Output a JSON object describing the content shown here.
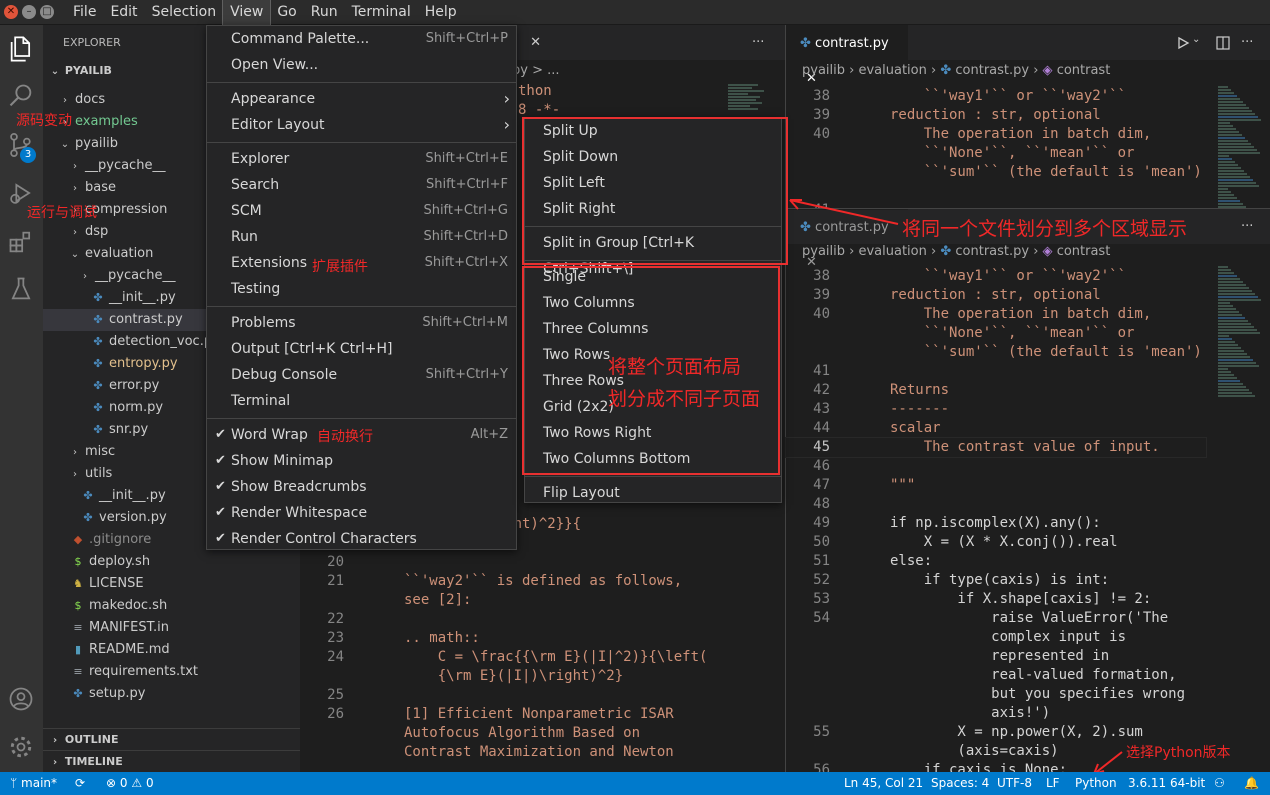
{
  "menubar": {
    "items": [
      "File",
      "Edit",
      "Selection",
      "View",
      "Go",
      "Run",
      "Terminal",
      "Help"
    ],
    "active": "View"
  },
  "sidebar": {
    "title": "EXPLORER",
    "root": "PYAILIB",
    "items": [
      {
        "label": "docs",
        "type": "folder",
        "depth": 1,
        "open": false
      },
      {
        "label": "examples",
        "type": "folder",
        "depth": 1,
        "open": false
      },
      {
        "label": "pyailib",
        "type": "folder",
        "depth": 1,
        "open": true
      },
      {
        "label": "__pycache__",
        "type": "folder",
        "depth": 2,
        "open": false
      },
      {
        "label": "base",
        "type": "folder",
        "depth": 2,
        "open": false
      },
      {
        "label": "compression",
        "type": "folder",
        "depth": 2,
        "open": false
      },
      {
        "label": "dsp",
        "type": "folder",
        "depth": 2,
        "open": false
      },
      {
        "label": "evaluation",
        "type": "folder",
        "depth": 2,
        "open": true
      },
      {
        "label": "__pycache__",
        "type": "folder",
        "depth": 3,
        "open": false
      },
      {
        "label": "__init__.py",
        "type": "py",
        "depth": 3
      },
      {
        "label": "contrast.py",
        "type": "py",
        "depth": 3,
        "selected": true
      },
      {
        "label": "detection_voc.py",
        "type": "py",
        "depth": 3
      },
      {
        "label": "entropy.py",
        "type": "py",
        "depth": 3
      },
      {
        "label": "error.py",
        "type": "py",
        "depth": 3
      },
      {
        "label": "norm.py",
        "type": "py",
        "depth": 3
      },
      {
        "label": "snr.py",
        "type": "py",
        "depth": 3
      },
      {
        "label": "misc",
        "type": "folder",
        "depth": 2,
        "open": false
      },
      {
        "label": "utils",
        "type": "folder",
        "depth": 2,
        "open": false
      },
      {
        "label": "__init__.py",
        "type": "py",
        "depth": 2
      },
      {
        "label": "version.py",
        "type": "py",
        "depth": 2
      },
      {
        "label": ".gitignore",
        "type": "git",
        "depth": 1
      },
      {
        "label": "deploy.sh",
        "type": "sh",
        "depth": 1
      },
      {
        "label": "LICENSE",
        "type": "lic",
        "depth": 1
      },
      {
        "label": "makedoc.sh",
        "type": "sh",
        "depth": 1
      },
      {
        "label": "MANIFEST.in",
        "type": "txt",
        "depth": 1
      },
      {
        "label": "README.md",
        "type": "md",
        "depth": 1
      },
      {
        "label": "requirements.txt",
        "type": "txt",
        "depth": 1
      },
      {
        "label": "setup.py",
        "type": "py",
        "depth": 1
      }
    ],
    "outline": "OUTLINE",
    "timeline": "TIMELINE"
  },
  "activity": {
    "scm_badge": "3"
  },
  "view_menu": [
    {
      "label": "Command Palette...",
      "kb": "Shift+Ctrl+P"
    },
    {
      "label": "Open View...",
      "kb": ""
    },
    {
      "sep": true
    },
    {
      "label": "Appearance",
      "sub": true
    },
    {
      "label": "Editor Layout",
      "sub": true
    },
    {
      "sep": true
    },
    {
      "label": "Explorer",
      "kb": "Shift+Ctrl+E"
    },
    {
      "label": "Search",
      "kb": "Shift+Ctrl+F"
    },
    {
      "label": "SCM",
      "kb": "Shift+Ctrl+G"
    },
    {
      "label": "Run",
      "kb": "Shift+Ctrl+D"
    },
    {
      "label": "Extensions",
      "kb": "Shift+Ctrl+X"
    },
    {
      "label": "Testing",
      "kb": ""
    },
    {
      "sep": true
    },
    {
      "label": "Problems",
      "kb": "Shift+Ctrl+M"
    },
    {
      "label": "Output [Ctrl+K Ctrl+H]",
      "kb": ""
    },
    {
      "label": "Debug Console",
      "kb": "Shift+Ctrl+Y"
    },
    {
      "label": "Terminal",
      "kb": ""
    },
    {
      "sep": true
    },
    {
      "label": "Word Wrap",
      "kb": "Alt+Z",
      "checked": true
    },
    {
      "label": "Show Minimap",
      "kb": "",
      "checked": true
    },
    {
      "label": "Show Breadcrumbs",
      "kb": "",
      "checked": true
    },
    {
      "label": "Render Whitespace",
      "kb": "",
      "checked": true
    },
    {
      "label": "Render Control Characters",
      "kb": "",
      "checked": true
    }
  ],
  "layout_submenu": [
    {
      "label": "Split Up"
    },
    {
      "label": "Split Down"
    },
    {
      "label": "Split Left"
    },
    {
      "label": "Split Right"
    },
    {
      "sep": true
    },
    {
      "label": "Split in Group [Ctrl+K Ctrl+Shift+\\]"
    },
    {
      "sep": true
    },
    {
      "label": "Single"
    },
    {
      "label": "Two Columns"
    },
    {
      "label": "Three Columns"
    },
    {
      "label": "Two Rows"
    },
    {
      "label": "Three Rows"
    },
    {
      "label": "Grid (2x2)"
    },
    {
      "label": "Two Rows Right"
    },
    {
      "label": "Two Columns Bottom"
    },
    {
      "sep": true
    },
    {
      "label": "Flip Layout"
    }
  ],
  "annotations": {
    "source_control": "源码变动",
    "run_debug": "运行与调试",
    "extensions": "扩展插件",
    "word_wrap": "自动换行",
    "split_same_file": "将同一个文件划分到多个区域显示",
    "layout_line1": "将整个页面布局",
    "layout_line2": "划分成不同子页面",
    "python_version": "选择Python版本"
  },
  "editor_left": {
    "tab_partial": "py",
    "crumb_partial": "py > ...",
    "frag_python": "thon",
    "frag_coding": "8 -*-",
    "lines": [
      {
        "n": "",
        "text": "E}(|I|^2)\\right)^2}}{"
      },
      {
        "n": "",
        "text": "^2)}"
      },
      {
        "n": "20",
        "text": ""
      },
      {
        "n": "21",
        "text": "``'way2'`` is defined as follows,"
      },
      {
        "n": "",
        "text": "see [2]:"
      },
      {
        "n": "22",
        "text": ""
      },
      {
        "n": "23",
        "text": ".. math::"
      },
      {
        "n": "24",
        "text": "    C = \\frac{{\\rm E}(|I|^2)}{\\left("
      },
      {
        "n": "",
        "text": "    {\\rm E}(|I|)\\right)^2}"
      },
      {
        "n": "25",
        "text": ""
      },
      {
        "n": "26",
        "text": "[1] Efficient Nonparametric ISAR"
      },
      {
        "n": "",
        "text": "Autofocus Algorithm Based on"
      },
      {
        "n": "",
        "text": "Contrast Maximization and Newton"
      }
    ]
  },
  "editor_right": {
    "tab": "contrast.py",
    "crumbs": {
      "a": "pyailib",
      "b": "evaluation",
      "c": "contrast.py",
      "d": "contrast"
    },
    "top_lines": [
      {
        "n": "38",
        "text": "    ``'way1'`` or ``'way2'``"
      },
      {
        "n": "39",
        "text": "reduction : str, optional"
      },
      {
        "n": "40",
        "text": "    The operation in batch dim,"
      },
      {
        "n": "",
        "text": "    ``'None'``, ``'mean'`` or"
      },
      {
        "n": "",
        "text": "    ``'sum'`` (the default is 'mean')"
      },
      {
        "n": "",
        "text": ""
      },
      {
        "n": "41",
        "text": ""
      },
      {
        "n": "",
        "text": "Returns"
      }
    ],
    "bottom_lines": [
      {
        "n": "38",
        "text": "    ``'way1'`` or ``'way2'``"
      },
      {
        "n": "39",
        "text": "reduction : str, optional"
      },
      {
        "n": "40",
        "text": "    The operation in batch dim,"
      },
      {
        "n": "",
        "text": "    ``'None'``, ``'mean'`` or"
      },
      {
        "n": "",
        "text": "    ``'sum'`` (the default is 'mean')"
      },
      {
        "n": "41",
        "text": ""
      },
      {
        "n": "42",
        "text": "Returns"
      },
      {
        "n": "43",
        "text": "-------"
      },
      {
        "n": "44",
        "text": "scalar"
      },
      {
        "n": "45",
        "text": "    The contrast value of input."
      },
      {
        "n": "46",
        "text": ""
      },
      {
        "n": "47",
        "text": "\"\"\""
      },
      {
        "n": "48",
        "text": ""
      },
      {
        "n": "49",
        "text": "if np.iscomplex(X).any():"
      },
      {
        "n": "50",
        "text": "    X = (X * X.conj()).real"
      },
      {
        "n": "51",
        "text": "else:"
      },
      {
        "n": "52",
        "text": "    if type(caxis) is int:"
      },
      {
        "n": "53",
        "text": "        if X.shape[caxis] != 2:"
      },
      {
        "n": "54",
        "text": "            raise ValueError('The"
      },
      {
        "n": "",
        "text": "            complex input is"
      },
      {
        "n": "",
        "text": "            represented in"
      },
      {
        "n": "",
        "text": "            real-valued formation,"
      },
      {
        "n": "",
        "text": "            but you specifies wrong"
      },
      {
        "n": "",
        "text": "            axis!')"
      },
      {
        "n": "55",
        "text": "        X = np.power(X, 2).sum"
      },
      {
        "n": "",
        "text": "        (axis=caxis)"
      },
      {
        "n": "56",
        "text": "    if caxis is None:"
      }
    ],
    "current_line": "45"
  },
  "statusbar": {
    "branch": "main*",
    "errors": "0",
    "warnings": "0",
    "position": "Ln 45, Col 21",
    "spaces": "Spaces: 4",
    "encoding": "UTF-8",
    "eol": "LF",
    "language": "Python",
    "interpreter": "3.6.11 64-bit"
  }
}
